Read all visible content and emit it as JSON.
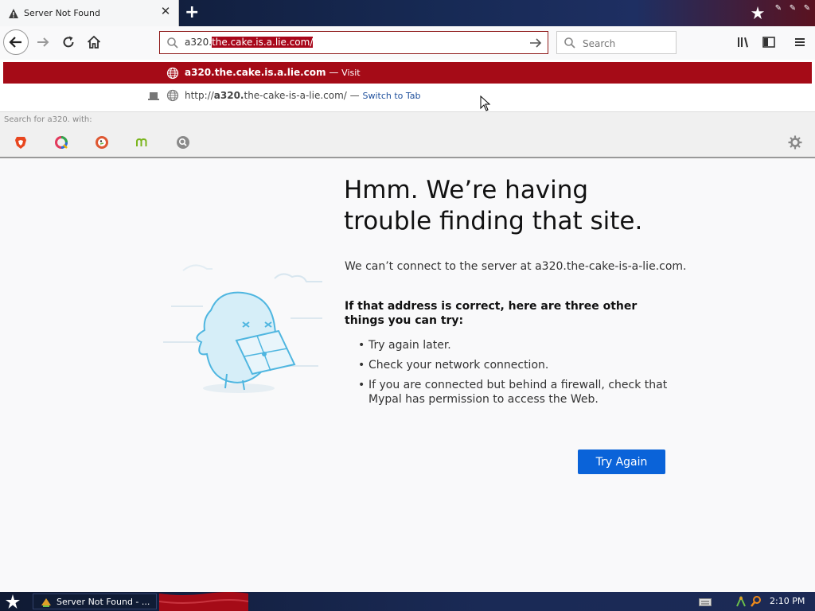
{
  "tab": {
    "title": "Server Not Found",
    "icon": "warning-icon"
  },
  "navbar": {
    "url_prefix": "a320.",
    "url_selected": "the.cake.is.a.lie.com/",
    "search_placeholder": "Search"
  },
  "dropdown": {
    "suggestion1": {
      "host_bold": "a320.",
      "host_rest": "the.cake.is.a.lie.com",
      "separator": " — ",
      "action": "Visit"
    },
    "suggestion2": {
      "prefix": "http://",
      "host_bold": "a320.",
      "host_rest": "the-cake-is-a-lie.com/",
      "separator": " — ",
      "action": "Switch to Tab"
    },
    "search_label": "Search for a320. with:",
    "engines": [
      "brave-icon",
      "qwant-icon",
      "duckduckgo-icon",
      "mojeek-icon",
      "search-engine-icon"
    ]
  },
  "error": {
    "title": "Hmm. We’re having trouble finding that site.",
    "description": "We can’t connect to the server at a320.the-cake-is-a-lie.com.",
    "subtitle": "If that address is correct, here are three other things you can try:",
    "items": [
      "Try again later.",
      "Check your network connection.",
      "If you are connected but behind a firewall, check that Mypal has permission to access the Web."
    ],
    "button": "Try Again"
  },
  "taskbar": {
    "task_label": "Server Not Found - ...",
    "clock": "2:10 PM"
  },
  "colors": {
    "accent_red": "#a50b17",
    "button_blue": "#0a63d9",
    "taskbar": "#1a2a56"
  }
}
